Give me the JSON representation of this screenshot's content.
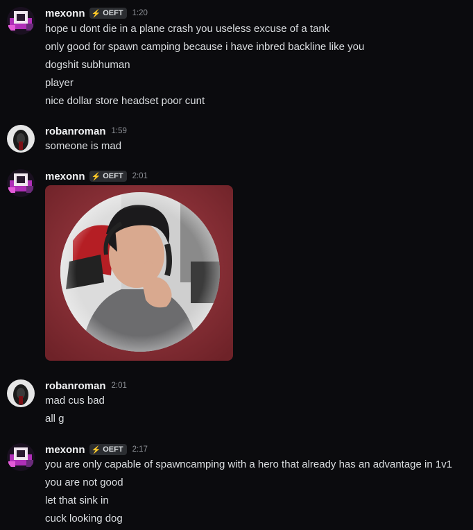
{
  "messages": [
    {
      "author": "mexonn",
      "tag": "OEFT",
      "tag_icon": "bolt-icon",
      "time": "1:20",
      "lines": [
        "hope u dont die in a plane crash you useless excuse of a tank",
        "only good for spawn camping because i have inbred backline like you",
        "dogshit subhuman",
        "player",
        "nice dollar store headset poor cunt"
      ]
    },
    {
      "author": "robanroman",
      "time": "1:59",
      "lines": [
        "someone is mad"
      ]
    },
    {
      "author": "mexonn",
      "tag": "OEFT",
      "time": "2:01",
      "attachment": "image-attachment"
    },
    {
      "author": "robanroman",
      "time": "2:01",
      "lines": [
        "mad cus bad",
        "all g"
      ]
    },
    {
      "author": "mexonn",
      "tag": "OEFT",
      "time": "2:17",
      "lines": [
        "you are only capable of spawncamping with a hero that already has an advantage in 1v1",
        "you are not good",
        "let that sink in",
        "cuck looking dog"
      ]
    }
  ],
  "colors": {
    "background": "#0b0b0e",
    "username": "#f2f3f5",
    "timestamp": "#8e9197",
    "tag_bg": "#2b2d31",
    "attachment_bg": "#8f2f35"
  }
}
